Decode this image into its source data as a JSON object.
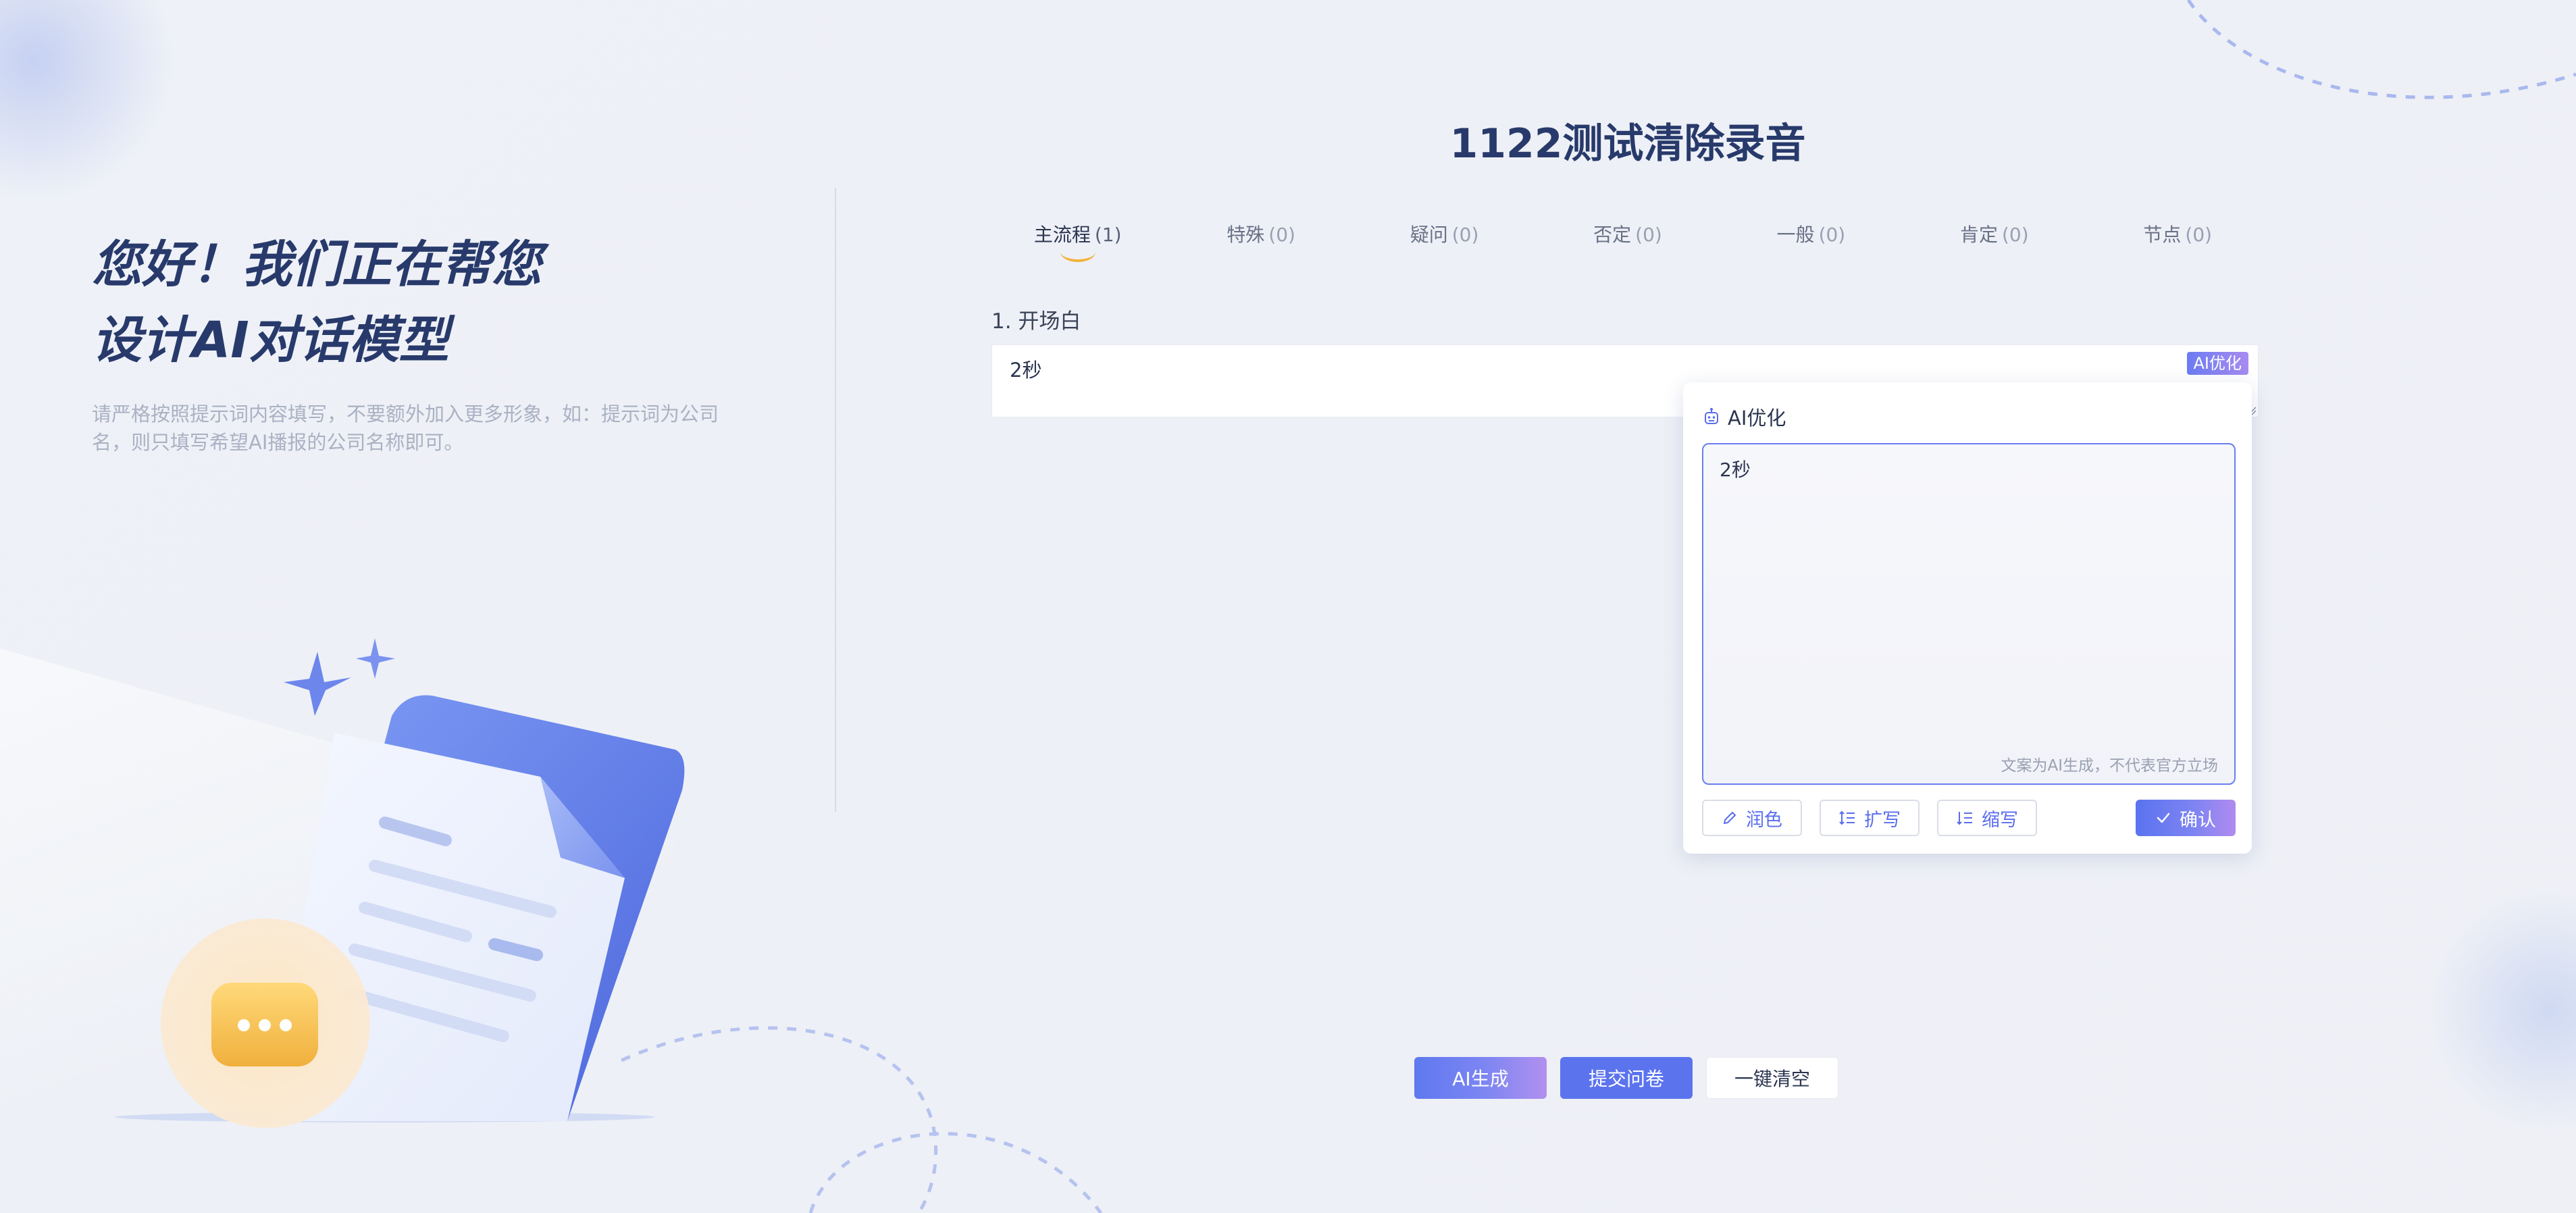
{
  "hero": {
    "title_line1": "您好！我们正在帮您",
    "title_line2": "设计AI对话模型",
    "description": "请严格按照提示词内容填写，不要额外加入更多形象，如：提示词为公司名，则只填写希望AI播报的公司名称即可。"
  },
  "page_title": "1122测试清除录音",
  "tabs": [
    {
      "label": "主流程",
      "count": "(1)",
      "active": true
    },
    {
      "label": "特殊",
      "count": "(0)",
      "active": false
    },
    {
      "label": "疑问",
      "count": "(0)",
      "active": false
    },
    {
      "label": "否定",
      "count": "(0)",
      "active": false
    },
    {
      "label": "一般",
      "count": "(0)",
      "active": false
    },
    {
      "label": "肯定",
      "count": "(0)",
      "active": false
    },
    {
      "label": "节点",
      "count": "(0)",
      "active": false
    }
  ],
  "question": {
    "label": "1. 开场白",
    "value": "2秒",
    "ai_optimize_tag": "AI优化"
  },
  "ai_popover": {
    "title": "AI优化",
    "text": "2秒",
    "disclaimer": "文案为AI生成，不代表官方立场",
    "buttons": {
      "polish": "润色",
      "expand": "扩写",
      "shrink": "缩写",
      "confirm": "确认"
    }
  },
  "bottom_buttons": {
    "ai_generate": "AI生成",
    "submit": "提交问卷",
    "clear": "一键清空"
  },
  "colors": {
    "title": "#283a6b",
    "accent": "#5b74ee",
    "gradient_end": "#b08bef",
    "tab_indicator": "#f2b33c"
  },
  "icons": [
    "robot-icon",
    "pencil-icon",
    "expand-list-icon",
    "shrink-list-icon",
    "check-icon",
    "document-illustration",
    "chat-bubble-icon",
    "sparkle-icon"
  ]
}
